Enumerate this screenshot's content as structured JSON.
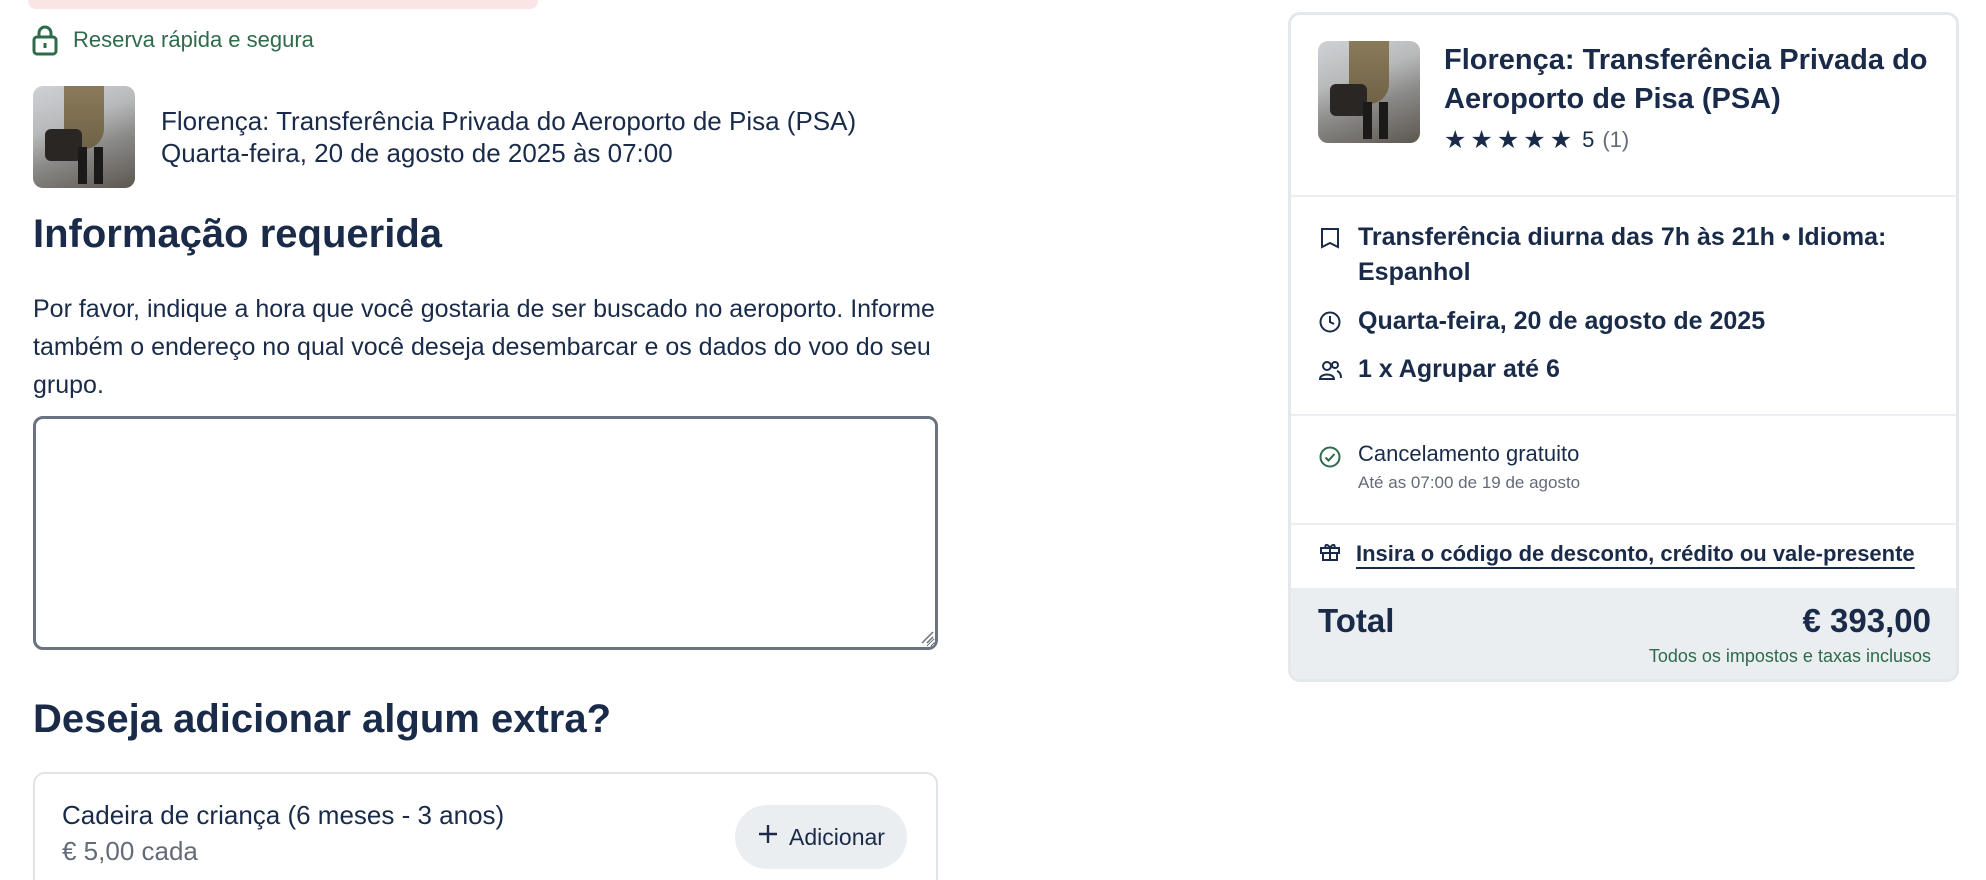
{
  "secure_badge": "Reserva rápida e segura",
  "booking": {
    "title": "Florença: Transferência Privada do Aeroporto de Pisa (PSA)",
    "datetime": "Quarta-feira, 20 de agosto de 2025 às 07:00"
  },
  "info_section": {
    "heading": "Informação requerida",
    "description": "Por favor, indique a hora que você gostaria de ser buscado no aeroporto. Informe também o endereço no qual você deseja desembarcar e os dados do voo do seu grupo.",
    "textarea_value": ""
  },
  "extras_section": {
    "heading": "Deseja adicionar algum extra?",
    "items": [
      {
        "name": "Cadeira de criança (6 meses - 3 anos)",
        "price": "€ 5,00 cada",
        "button_label": "Adicionar"
      }
    ]
  },
  "summary": {
    "title": "Florença: Transferência Privada do Aeroporto de Pisa (PSA)",
    "rating_value": "5",
    "rating_count": "(1)",
    "stars": 5,
    "option": "Transferência diurna das 7h às 21h • Idioma: Espanhol",
    "date": "Quarta-feira, 20 de agosto de 2025",
    "participants": "1 x Agrupar até 6",
    "cancellation_title": "Cancelamento gratuito",
    "cancellation_detail": "Até as 07:00 de 19 de agosto",
    "promo_link": "Insira o código de desconto, crédito ou vale-presente",
    "total_label": "Total",
    "total_price": "€ 393,00",
    "total_note": "Todos os impostos e taxas inclusos"
  },
  "colors": {
    "primary_text": "#1a2b49",
    "secure_green": "#2e6b4a",
    "muted": "#646b78",
    "panel_bg": "#ebeef1"
  }
}
